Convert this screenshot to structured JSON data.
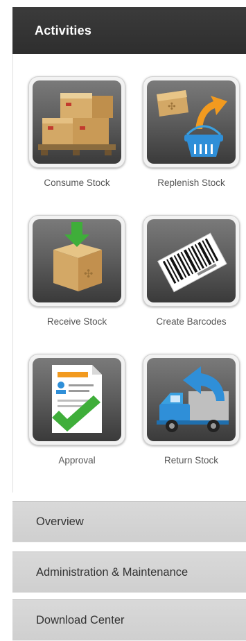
{
  "header": {
    "title": "Activities"
  },
  "tiles": [
    {
      "label": "Consume Stock",
      "icon": "pallet-boxes-icon"
    },
    {
      "label": "Replenish Stock",
      "icon": "box-to-basket-icon"
    },
    {
      "label": "Receive Stock",
      "icon": "box-download-icon"
    },
    {
      "label": "Create Barcodes",
      "icon": "barcode-icon"
    },
    {
      "label": "Approval",
      "icon": "approval-document-icon"
    },
    {
      "label": "Return Stock",
      "icon": "return-truck-icon"
    }
  ],
  "accordion": [
    {
      "label": "Overview"
    },
    {
      "label": "Administration & Maintenance"
    },
    {
      "label": "Download Center"
    }
  ],
  "colors": {
    "header_bg": "#333333",
    "tile_bg": "#5f5f5f",
    "accordion_bg": "#d4d4d4",
    "accent_green": "#3fae3a",
    "accent_blue": "#2f8fd8",
    "accent_orange": "#f29a1f"
  }
}
